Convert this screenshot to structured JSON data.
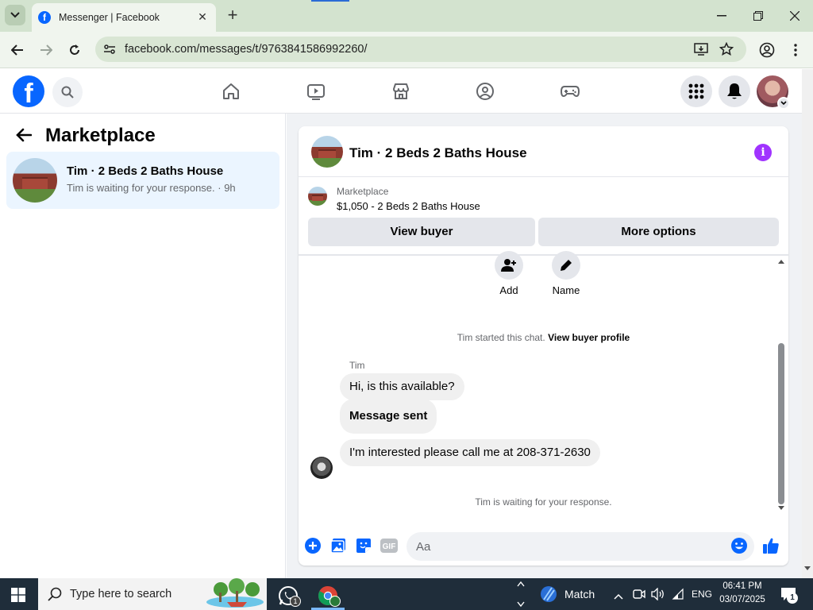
{
  "browser": {
    "tab_title": "Messenger | Facebook",
    "url": "facebook.com/messages/t/9763841586992260/"
  },
  "left": {
    "title": "Marketplace",
    "conversation": {
      "name": "Tim · 2 Beds 2 Baths House",
      "subtitle": "Tim is waiting for your response. · 9h"
    }
  },
  "chat": {
    "name": "Tim · 2 Beds 2 Baths House",
    "marketplace_label": "Marketplace",
    "listing": "$1,050 - 2 Beds 2 Baths House",
    "view_buyer": "View buyer",
    "more_options": "More options",
    "tool_add": "Add",
    "tool_name": "Name",
    "started_text": "Tim started this chat.",
    "view_profile": "View buyer profile",
    "sender": "Tim",
    "messages": [
      "Hi, is this available?",
      "Message sent",
      "I'm interested please call me at 208-371-2630"
    ],
    "waiting": "Tim is waiting for your response.",
    "input_placeholder": "Aa",
    "gif_label": "GIF"
  },
  "taskbar": {
    "search_placeholder": "Type here to search",
    "whatsapp_badge": "1",
    "match_label": "Match",
    "language": "ENG",
    "time": "06:41 PM",
    "date": "03/07/2025",
    "notification_count": "1"
  },
  "colors": {
    "fb_blue": "#0866ff",
    "messenger_purple": "#a033ff",
    "selected_bg": "#ebf5ff"
  }
}
